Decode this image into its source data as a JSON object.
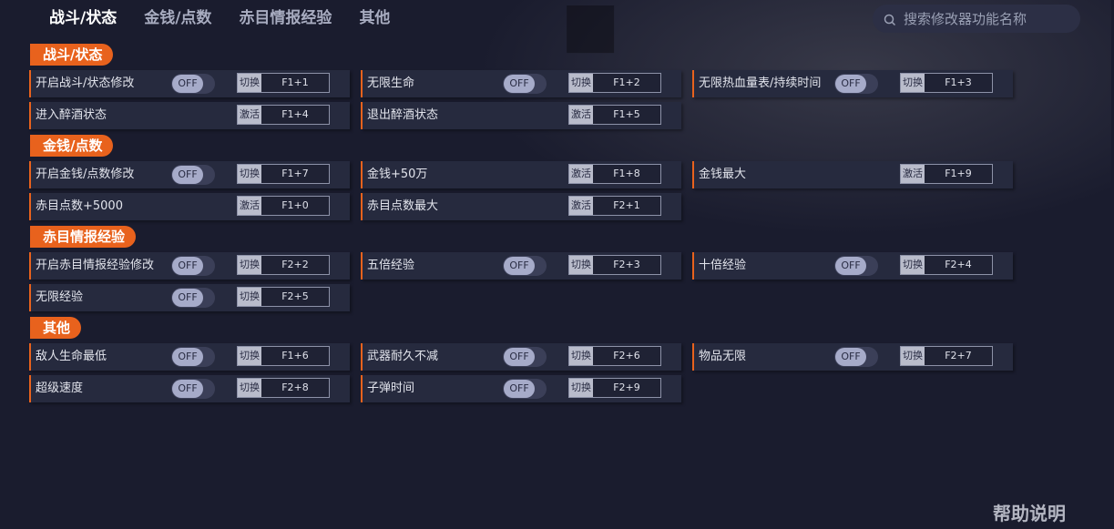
{
  "nav": {
    "tabs": [
      "战斗/状态",
      "金钱/点数",
      "赤目情报经验",
      "其他"
    ],
    "active": 0
  },
  "search": {
    "placeholder": "搜索修改器功能名称",
    "icon": "search-icon"
  },
  "colors": {
    "accent": "#e8621d",
    "background": "#1a1c2e",
    "card": "#262a3e"
  },
  "sections": [
    {
      "title": "战斗/状态",
      "items": [
        {
          "label": "开启战斗/状态修改",
          "toggle": "OFF",
          "action": "切换",
          "key": "F1+1"
        },
        {
          "label": "无限生命",
          "toggle": "OFF",
          "action": "切换",
          "key": "F1+2"
        },
        {
          "label": "无限热血量表/持续时间",
          "toggle": "OFF",
          "action": "切换",
          "key": "F1+3"
        },
        {
          "label": "进入醉酒状态",
          "toggle": null,
          "action": "激活",
          "key": "F1+4"
        },
        {
          "label": "退出醉酒状态",
          "toggle": null,
          "action": "激活",
          "key": "F1+5"
        }
      ]
    },
    {
      "title": "金钱/点数",
      "items": [
        {
          "label": "开启金钱/点数修改",
          "toggle": "OFF",
          "action": "切换",
          "key": "F1+7"
        },
        {
          "label": "金钱+50万",
          "toggle": null,
          "action": "激活",
          "key": "F1+8"
        },
        {
          "label": "金钱最大",
          "toggle": null,
          "action": "激活",
          "key": "F1+9"
        },
        {
          "label": "赤目点数+5000",
          "toggle": null,
          "action": "激活",
          "key": "F1+0"
        },
        {
          "label": "赤目点数最大",
          "toggle": null,
          "action": "激活",
          "key": "F2+1"
        }
      ]
    },
    {
      "title": "赤目情报经验",
      "items": [
        {
          "label": "开启赤目情报经验修改",
          "toggle": "OFF",
          "action": "切换",
          "key": "F2+2"
        },
        {
          "label": "五倍经验",
          "toggle": "OFF",
          "action": "切换",
          "key": "F2+3"
        },
        {
          "label": "十倍经验",
          "toggle": "OFF",
          "action": "切换",
          "key": "F2+4"
        },
        {
          "label": "无限经验",
          "toggle": "OFF",
          "action": "切换",
          "key": "F2+5"
        }
      ]
    },
    {
      "title": "其他",
      "items": [
        {
          "label": "敌人生命最低",
          "toggle": "OFF",
          "action": "切换",
          "key": "F1+6"
        },
        {
          "label": "武器耐久不减",
          "toggle": "OFF",
          "action": "切换",
          "key": "F2+6"
        },
        {
          "label": "物品无限",
          "toggle": "OFF",
          "action": "切换",
          "key": "F2+7"
        },
        {
          "label": "超级速度",
          "toggle": "OFF",
          "action": "切换",
          "key": "F2+8"
        },
        {
          "label": "子弹时间",
          "toggle": "OFF",
          "action": "切换",
          "key": "F2+9"
        }
      ]
    }
  ],
  "help": {
    "label": "帮助说明"
  }
}
